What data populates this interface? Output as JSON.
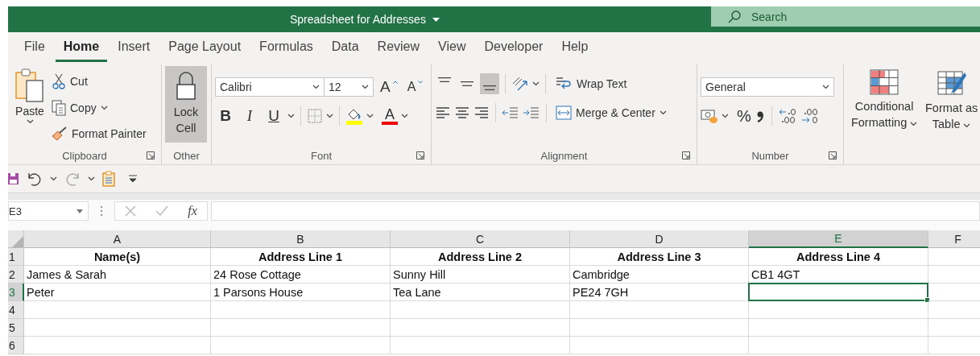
{
  "title_bar": {
    "title": "Spreadsheet for Addresses",
    "search_placeholder": "Search"
  },
  "menu_tabs": [
    {
      "label": "File",
      "selected": false
    },
    {
      "label": "Home",
      "selected": true
    },
    {
      "label": "Insert",
      "selected": false
    },
    {
      "label": "Page Layout",
      "selected": false
    },
    {
      "label": "Formulas",
      "selected": false
    },
    {
      "label": "Data",
      "selected": false
    },
    {
      "label": "Review",
      "selected": false
    },
    {
      "label": "View",
      "selected": false
    },
    {
      "label": "Developer",
      "selected": false
    },
    {
      "label": "Help",
      "selected": false
    }
  ],
  "ribbon": {
    "clipboard": {
      "paste": "Paste",
      "cut": "Cut",
      "copy": "Copy",
      "format_painter": "Format Painter",
      "label": "Clipboard"
    },
    "other": {
      "lock_cell": "Lock Cell",
      "pressed": true,
      "label": "Other"
    },
    "font": {
      "font_name": "Calibri",
      "font_size": "12",
      "grow_font": "A",
      "shrink_font": "A",
      "format_buttons": [
        {
          "kind": "bold",
          "label": "B"
        },
        {
          "kind": "italic",
          "label": "I"
        },
        {
          "kind": "underline",
          "label": "U"
        }
      ],
      "font_color": "A",
      "label": "Font"
    },
    "alignment": {
      "vertical_align": [
        {
          "kind": "top",
          "selected": false
        },
        {
          "kind": "middle",
          "selected": false
        },
        {
          "kind": "bottom",
          "selected": true
        }
      ],
      "wrap_text": "Wrap Text",
      "merge": "Merge & Center",
      "label": "Alignment"
    },
    "number": {
      "format": "General",
      "percent": "%",
      "label": "Number"
    },
    "styles": [
      {
        "kind": "conditional",
        "label": "Conditional Formatting"
      },
      {
        "kind": "table",
        "label": "Format as Table"
      }
    ]
  },
  "formula_bar": {
    "name_box": "E3",
    "function_label": "fx"
  },
  "sheet": {
    "columns": [
      {
        "letter": "A",
        "selected": false
      },
      {
        "letter": "B",
        "selected": false
      },
      {
        "letter": "C",
        "selected": false
      },
      {
        "letter": "D",
        "selected": false
      },
      {
        "letter": "E",
        "selected": true
      },
      {
        "letter": "F",
        "selected": false
      }
    ],
    "rows": [
      {
        "number": "1",
        "kind": "header",
        "selected": false,
        "cells": [
          "Name(s)",
          "Address Line 1",
          "Address Line 2",
          "Address Line 3",
          "Address Line 4"
        ]
      },
      {
        "number": "2",
        "kind": "data",
        "selected": false,
        "cells": [
          "James & Sarah",
          "24 Rose Cottage",
          "Sunny Hill",
          "Cambridge",
          "CB1 4GT"
        ]
      },
      {
        "number": "3",
        "kind": "data",
        "selected": true,
        "cells": [
          "Peter",
          "1 Parsons House",
          "Tea Lane",
          "PE24 7GH"
        ]
      },
      {
        "number": "4",
        "kind": "data",
        "selected": false
      },
      {
        "number": "5",
        "kind": "data",
        "selected": false
      },
      {
        "number": "6",
        "kind": "data",
        "selected": false
      }
    ]
  }
}
